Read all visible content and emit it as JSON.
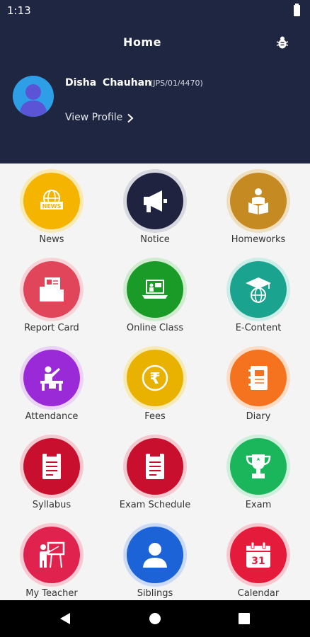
{
  "status_bar": {
    "time": "1:13"
  },
  "header": {
    "title": "Home"
  },
  "profile": {
    "name": "Disha  Chauhan",
    "id": "(JPS/01/4470)",
    "view_profile_label": "View Profile"
  },
  "tiles": [
    {
      "label": "News",
      "icon": "news-icon",
      "color": "#f4b400"
    },
    {
      "label": "Notice",
      "icon": "megaphone-icon",
      "color": "#1f2340"
    },
    {
      "label": "Homeworks",
      "icon": "reading-student-icon",
      "color": "#c58a22"
    },
    {
      "label": "Report Card",
      "icon": "report-folder-icon",
      "color": "#e0455a"
    },
    {
      "label": "Online Class",
      "icon": "laptop-class-icon",
      "color": "#1a9a27"
    },
    {
      "label": "E-Content",
      "icon": "graduation-globe-icon",
      "color": "#1aa38f"
    },
    {
      "label": "Attendance",
      "icon": "teacher-desk-icon",
      "color": "#9a29d8"
    },
    {
      "label": "Fees",
      "icon": "rupee-icon",
      "color": "#e9b100"
    },
    {
      "label": "Diary",
      "icon": "diary-icon",
      "color": "#f5731f"
    },
    {
      "label": "Syllabus",
      "icon": "document-icon",
      "color": "#c8102e"
    },
    {
      "label": "Exam Schedule",
      "icon": "document-icon",
      "color": "#c8102e"
    },
    {
      "label": "Exam",
      "icon": "trophy-icon",
      "color": "#1bb55c"
    },
    {
      "label": "My Teacher",
      "icon": "teacher-board-icon",
      "color": "#e0234e"
    },
    {
      "label": "Siblings",
      "icon": "person-icon",
      "color": "#1d63d8"
    },
    {
      "label": "Calendar",
      "icon": "calendar-icon",
      "color": "#e41b3a"
    }
  ],
  "calendar_day": "31"
}
